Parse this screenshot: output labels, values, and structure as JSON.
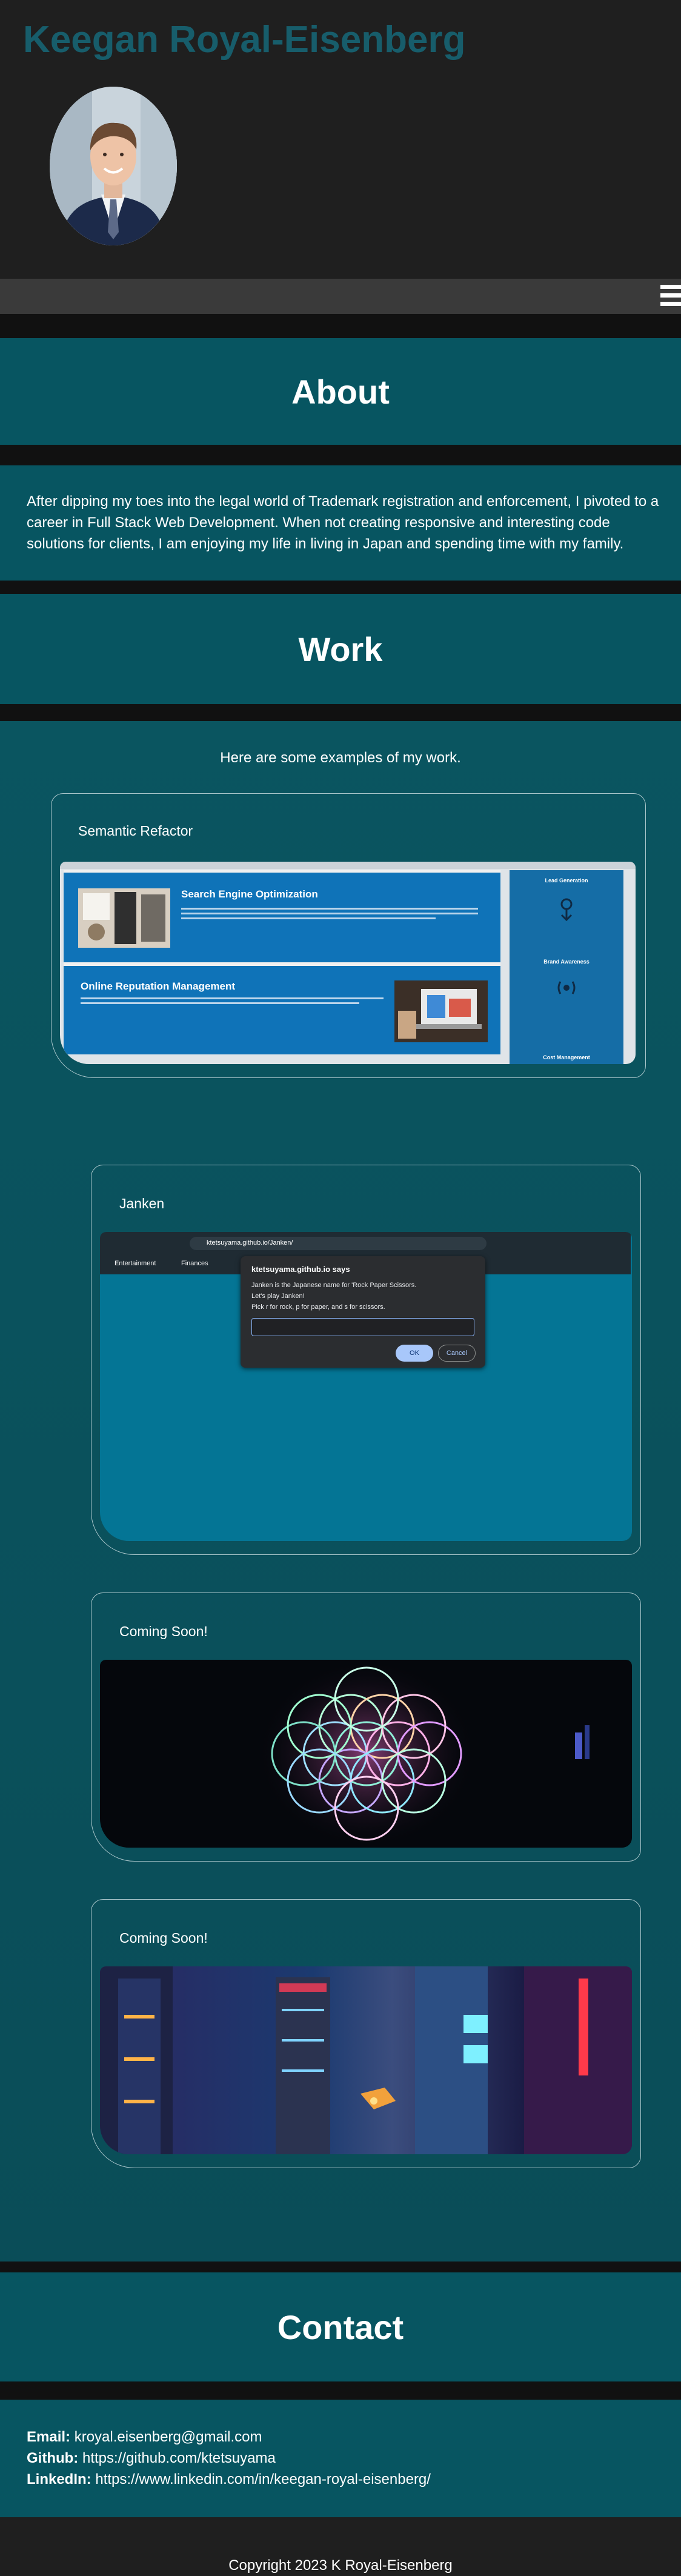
{
  "header": {
    "site_title": "Keegan Royal-Eisenberg"
  },
  "about": {
    "heading": "About",
    "text": "After dipping my toes into the legal world of Trademark registration and enforcement, I pivoted to a career in Full Stack Web Development. When not creating responsive and interesting code solutions for clients, I am enjoying my life in living in Japan and spending time with my family."
  },
  "work": {
    "heading": "Work",
    "intro": "Here are some examples of my work.",
    "projects": [
      {
        "title": "Semantic Refactor",
        "screenshot": {
          "panel1_title": "Search Engine Optimization",
          "panel2_title": "Online Reputation Management",
          "side1_title": "Lead Generation",
          "side2_title": "Brand Awareness",
          "side3_title": "Cost Management"
        }
      },
      {
        "title": "Janken",
        "screenshot": {
          "url": "ktetsuyama.github.io/Janken/",
          "bookmarks": [
            "Entertainment",
            "Finances"
          ],
          "dialog_title": "ktetsuyama.github.io says",
          "dialog_lines": [
            "Janken is the Japanese name for 'Rock Paper Scissors.",
            "Let's play Janken!",
            "Pick r for rock, p for paper, and s for scissors."
          ],
          "ok_label": "OK",
          "cancel_label": "Cancel"
        }
      },
      {
        "title": "Coming Soon!"
      },
      {
        "title": "Coming Soon!"
      }
    ]
  },
  "contact": {
    "heading": "Contact",
    "email_label": "Email:",
    "email": "kroyal.eisenberg@gmail.com",
    "github_label": "Github:",
    "github": "https://github.com/ktetsuyama",
    "linkedin_label": "LinkedIn:",
    "linkedin": "https://www.linkedin.com/in/keegan-royal-eisenberg/"
  },
  "footer": {
    "copyright": "Copyright 2023 K Royal-Eisenberg"
  },
  "colors": {
    "title_teal": "#175d6b",
    "section_teal": "#075561",
    "dark": "#1f1f1f",
    "band_black": "#111111"
  },
  "icons": [
    "hamburger-menu-icon"
  ]
}
